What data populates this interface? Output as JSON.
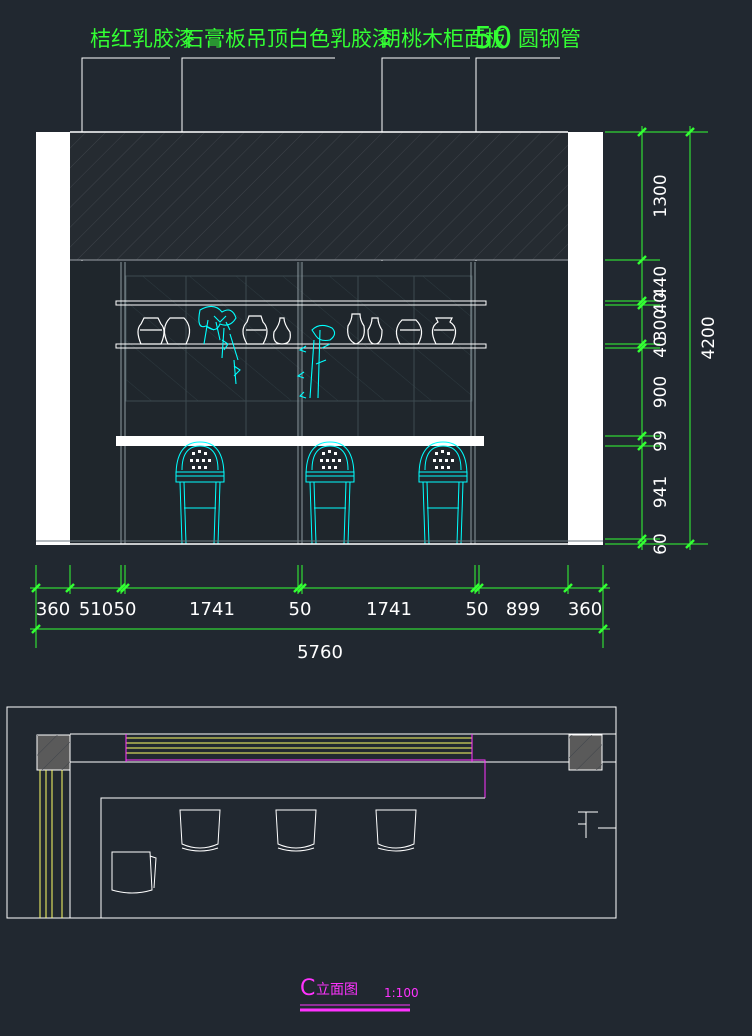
{
  "labels": {
    "wall_paint": "桔红乳胶漆",
    "ceiling": "石膏板吊顶白色乳胶漆",
    "cabinet_panel": "胡桃木柜面板",
    "steel_pipe_size": "50",
    "steel_pipe": "圆钢管"
  },
  "dims_horizontal": [
    "360",
    "510",
    "50",
    "1741",
    "50",
    "1741",
    "50",
    "899",
    "360"
  ],
  "dim_total_width": "5760",
  "dims_vertical": [
    "1300",
    "440",
    "40",
    "300",
    "40",
    "900",
    "99",
    "941",
    "60"
  ],
  "dim_total_height": "4200",
  "plan_title": {
    "letter": "C",
    "text": "立面图",
    "scale": "1:100"
  },
  "colors": {
    "background": "#212830",
    "outline": "#ffffff",
    "dimension": "#33ff33",
    "furniture": "#00ffff",
    "hatch": "#4a4a4a",
    "plan_detail": "#ffff66",
    "title": "#ff33ff"
  }
}
